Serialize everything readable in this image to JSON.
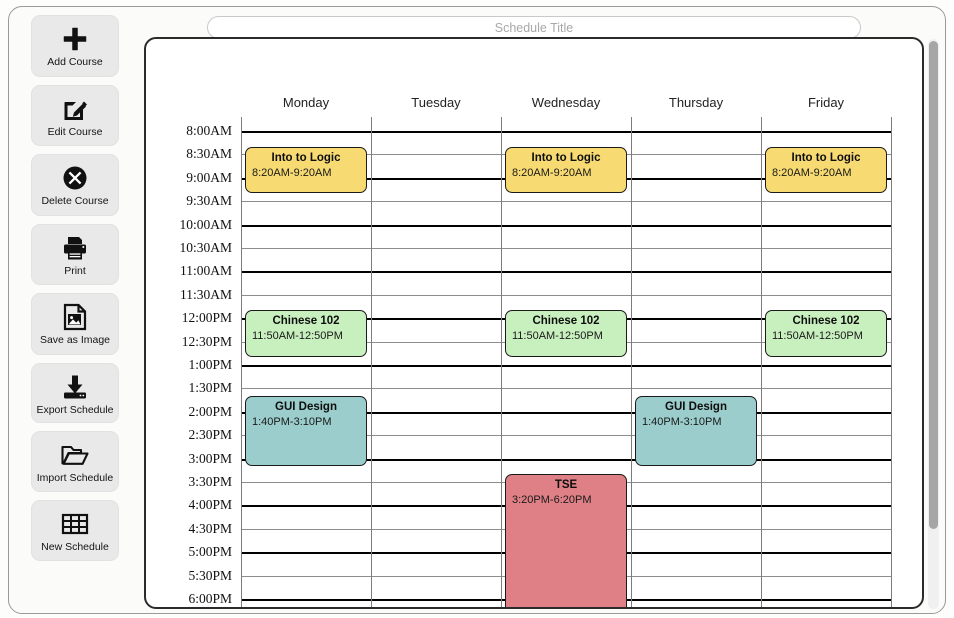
{
  "window": {
    "title_placeholder": "Schedule Title",
    "title_value": ""
  },
  "sidebar": {
    "items": [
      {
        "label": "Add Course",
        "icon": "plus-icon",
        "name": "add-course"
      },
      {
        "label": "Edit Course",
        "icon": "pencil-edit-icon",
        "name": "edit-course"
      },
      {
        "label": "Delete Course",
        "icon": "delete-circle-icon",
        "name": "delete-course"
      },
      {
        "label": "Print",
        "icon": "printer-icon",
        "name": "print"
      },
      {
        "label": "Save as Image",
        "icon": "image-file-icon",
        "name": "save-as-image"
      },
      {
        "label": "Export Schedule",
        "icon": "export-download-icon",
        "name": "export-schedule"
      },
      {
        "label": "Import Schedule",
        "icon": "folder-open-icon",
        "name": "import-schedule"
      },
      {
        "label": "New Schedule",
        "icon": "grid-table-icon",
        "name": "new-schedule"
      }
    ]
  },
  "calendar": {
    "days": [
      "Monday",
      "Tuesday",
      "Wednesday",
      "Thursday",
      "Friday"
    ],
    "times": [
      "8:00AM",
      "8:30AM",
      "9:00AM",
      "9:30AM",
      "10:00AM",
      "10:30AM",
      "11:00AM",
      "11:30AM",
      "12:00PM",
      "12:30PM",
      "1:00PM",
      "1:30PM",
      "2:00PM",
      "2:30PM",
      "3:00PM",
      "3:30PM",
      "4:00PM",
      "4:30PM",
      "5:00PM",
      "5:30PM",
      "6:00PM"
    ],
    "courses": [
      {
        "name": "Into to Logic",
        "time": "8:20AM-9:20AM",
        "day": "Monday",
        "color": "#F7DB72"
      },
      {
        "name": "Into to Logic",
        "time": "8:20AM-9:20AM",
        "day": "Wednesday",
        "color": "#F7DB72"
      },
      {
        "name": "Into to Logic",
        "time": "8:20AM-9:20AM",
        "day": "Friday",
        "color": "#F7DB72"
      },
      {
        "name": "Chinese 102",
        "time": "11:50AM-12:50PM",
        "day": "Monday",
        "color": "#C8EFBE"
      },
      {
        "name": "Chinese 102",
        "time": "11:50AM-12:50PM",
        "day": "Wednesday",
        "color": "#C8EFBE"
      },
      {
        "name": "Chinese 102",
        "time": "11:50AM-12:50PM",
        "day": "Friday",
        "color": "#C8EFBE"
      },
      {
        "name": "GUI Design",
        "time": "1:40PM-3:10PM",
        "day": "Monday",
        "color": "#9ACDCB"
      },
      {
        "name": "GUI Design",
        "time": "1:40PM-3:10PM",
        "day": "Thursday",
        "color": "#9ACDCB"
      },
      {
        "name": "TSE",
        "time": "3:20PM-6:20PM",
        "day": "Wednesday",
        "color": "#DE8086"
      }
    ]
  },
  "scrollbar": {
    "orientation": "vertical"
  }
}
